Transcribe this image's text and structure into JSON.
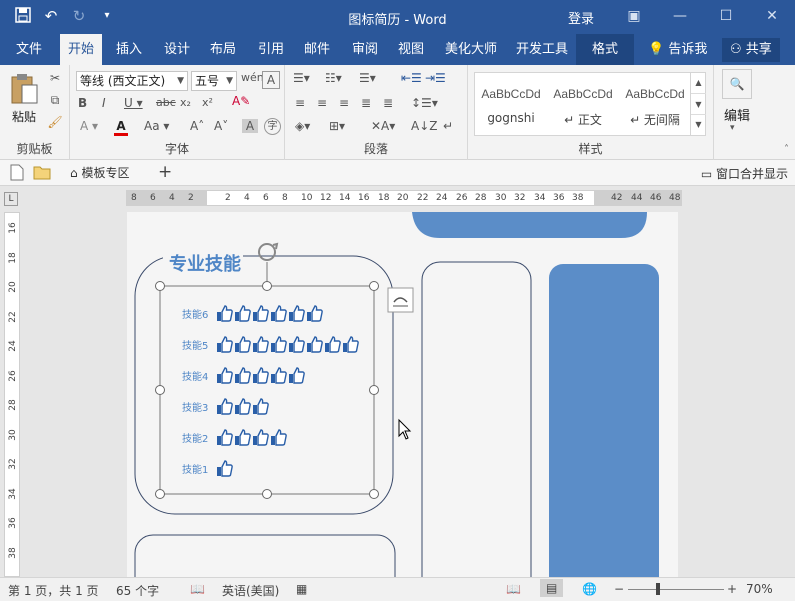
{
  "titlebar": {
    "title": "图标简历  -  Word",
    "login": "登录"
  },
  "tabs": [
    {
      "label": "文件"
    },
    {
      "label": "开始"
    },
    {
      "label": "插入"
    },
    {
      "label": "设计"
    },
    {
      "label": "布局"
    },
    {
      "label": "引用"
    },
    {
      "label": "邮件"
    },
    {
      "label": "审阅"
    },
    {
      "label": "视图"
    },
    {
      "label": "美化大师"
    },
    {
      "label": "开发工具"
    },
    {
      "label": "格式"
    }
  ],
  "tell_me": "告诉我",
  "share": "共享",
  "ribbon": {
    "clipboard": {
      "paste": "粘贴",
      "label": "剪贴板"
    },
    "font": {
      "font_name": "等线 (西文正文)",
      "font_size": "五号",
      "label": "字体"
    },
    "paragraph": {
      "label": "段落"
    },
    "styles": {
      "label": "样式",
      "items": [
        {
          "sample": "AaBbCcDd",
          "name": "gognshi"
        },
        {
          "sample": "AaBbCcDd",
          "name": "↵ 正文"
        },
        {
          "sample": "AaBbCcDd",
          "name": "↵ 无间隔"
        }
      ]
    },
    "editing": {
      "label": "编辑"
    }
  },
  "quickbar": {
    "template": "模板专区",
    "merge": "窗口合并显示"
  },
  "ruler": {
    "h_ticks": [
      "8",
      "6",
      "4",
      "2",
      "2",
      "4",
      "6",
      "8",
      "10",
      "12",
      "14",
      "16",
      "18",
      "20",
      "22",
      "24",
      "26",
      "28",
      "30",
      "32",
      "34",
      "36",
      "38",
      "42",
      "44",
      "46",
      "48"
    ],
    "v_ticks": [
      "16",
      "18",
      "20",
      "22",
      "24",
      "26",
      "28",
      "30",
      "32",
      "34",
      "36",
      "38"
    ],
    "corner": "L"
  },
  "document": {
    "section_title": "专业技能",
    "skills": [
      {
        "label": "技能6",
        "thumbs": 6
      },
      {
        "label": "技能5",
        "thumbs": 8
      },
      {
        "label": "技能4",
        "thumbs": 5
      },
      {
        "label": "技能3",
        "thumbs": 3
      },
      {
        "label": "技能2",
        "thumbs": 4
      },
      {
        "label": "技能1",
        "thumbs": 1
      }
    ]
  },
  "statusbar": {
    "page": "第 1 页，共 1 页",
    "words": "65 个字",
    "language": "英语(美国)",
    "zoom": "70%"
  },
  "colors": {
    "word_blue": "#2b579a",
    "accent": "#4f86c6",
    "thumb_blue": "#2a5fa8"
  }
}
